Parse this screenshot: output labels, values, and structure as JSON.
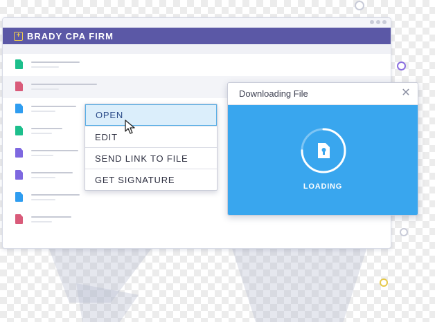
{
  "app": {
    "firm_name": "BRADY CPA FIRM",
    "brand_color": "#5b58a6",
    "logo_color": "#f2cf4a"
  },
  "files": [
    {
      "icon_color": "#1dbf8c",
      "highlight": false
    },
    {
      "icon_color": "#d95b7a",
      "highlight": true
    },
    {
      "icon_color": "#2f9df0",
      "highlight": false
    },
    {
      "icon_color": "#1dbf8c",
      "highlight": false
    },
    {
      "icon_color": "#7e68e0",
      "highlight": false
    },
    {
      "icon_color": "#7e68e0",
      "highlight": false
    },
    {
      "icon_color": "#2f9df0",
      "highlight": false
    },
    {
      "icon_color": "#d95b7a",
      "highlight": false
    }
  ],
  "context_menu": {
    "items": [
      {
        "label": "OPEN",
        "active": true
      },
      {
        "label": "EDIT",
        "active": false
      },
      {
        "label": "SEND LINK TO FILE",
        "active": false
      },
      {
        "label": "GET SIGNATURE",
        "active": false
      }
    ]
  },
  "dialog": {
    "title": "Downloading File",
    "close_icon": "close-icon",
    "status": "LOADING",
    "accent_color": "#39a6ee",
    "progress": 0.75
  }
}
